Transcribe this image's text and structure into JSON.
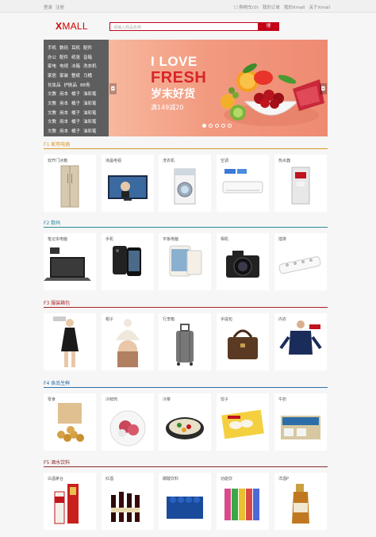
{
  "topbar": {
    "login": "登录",
    "register": "注册",
    "cart": "☐ 购物车(0)",
    "orders": "我的订单",
    "my": "我的Xmall",
    "about": "关于Xmall"
  },
  "header": {
    "logo_x": "X",
    "logo_rest": "MALL",
    "search_placeholder": "请输入商品名称",
    "search_button": "搜"
  },
  "category_menu": [
    [
      "手机",
      "数码",
      "耳机",
      "配件"
    ],
    [
      "办公",
      "配件",
      "纸张",
      "音箱"
    ],
    [
      "家电",
      "电视",
      "冰箱",
      "洗衣机"
    ],
    [
      "家居",
      "家装",
      "整纸",
      "马桶"
    ],
    [
      "化妆品",
      "护肤品",
      "88青"
    ],
    [
      "文教",
      "用本",
      "橘子",
      "油彩笔"
    ],
    [
      "文教",
      "用本",
      "橘子",
      "油彩笔"
    ],
    [
      "文教",
      "用本",
      "橘子",
      "油彩笔"
    ],
    [
      "文教",
      "用本",
      "橘子",
      "油彩笔"
    ],
    [
      "文教",
      "用本",
      "橘子",
      "油彩笔"
    ]
  ],
  "banner": {
    "line1": "I LOVE",
    "line2": "FRESH",
    "line3": "岁末好货",
    "line4": "满149减20",
    "prev": "◘",
    "next": "◘",
    "dot_count": 5,
    "active_dot": 0
  },
  "floors": [
    {
      "title": "F1 家用电器",
      "color": "#d89a2e",
      "items": [
        {
          "name": "双开门冰箱",
          "icon": "fridge-icon"
        },
        {
          "name": "液晶电视",
          "icon": "tv-icon"
        },
        {
          "name": "洗衣机",
          "icon": "washer-icon"
        },
        {
          "name": "空调",
          "icon": "air-conditioner-icon"
        },
        {
          "name": "热水器",
          "icon": "water-heater-icon"
        }
      ]
    },
    {
      "title": "F2 数码",
      "color": "#2e8a9a",
      "items": [
        {
          "name": "笔记本电脑",
          "icon": "laptop-icon"
        },
        {
          "name": "手机",
          "icon": "phone-icon"
        },
        {
          "name": "平板电脑",
          "icon": "tablet-icon"
        },
        {
          "name": "相机",
          "icon": "camera-icon"
        },
        {
          "name": "插排",
          "icon": "power-strip-icon"
        }
      ]
    },
    {
      "title": "F3 服装箱包",
      "color": "#a82222",
      "items": [
        {
          "name": "",
          "icon": "dress-icon"
        },
        {
          "name": "帽子",
          "icon": "hat-icon"
        },
        {
          "name": "行李箱",
          "icon": "suitcase-icon"
        },
        {
          "name": "手提包",
          "icon": "handbag-icon"
        },
        {
          "name": "内衣",
          "icon": "underwear-icon"
        }
      ]
    },
    {
      "title": "F4 食品生鲜",
      "color": "#2e6ea8",
      "items": [
        {
          "name": "零食",
          "icon": "snack-icon"
        },
        {
          "name": "冷鲜肉",
          "icon": "meat-icon"
        },
        {
          "name": "冷菜",
          "icon": "dish-icon"
        },
        {
          "name": "饺子",
          "icon": "dumpling-icon"
        },
        {
          "name": "牛奶",
          "icon": "milk-icon"
        }
      ]
    },
    {
      "title": "F5 酒水饮料",
      "color": "#8a2a2a",
      "items": [
        {
          "name": "白酒茅台",
          "icon": "baijiu-icon"
        },
        {
          "name": "红酒",
          "icon": "red-wine-icon"
        },
        {
          "name": "碳酸饮料",
          "icon": "soda-icon"
        },
        {
          "name": "功能饮",
          "icon": "energy-drink-icon"
        },
        {
          "name": "洋酒P",
          "icon": "whisky-icon"
        }
      ]
    }
  ]
}
